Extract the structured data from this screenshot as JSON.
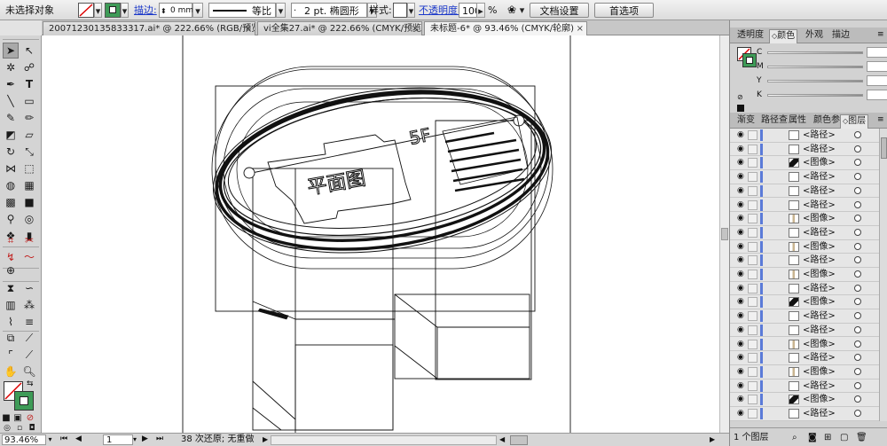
{
  "control_bar": {
    "selection_status": "未选择对象",
    "stroke_label": "描边:",
    "stroke_weight": "0 mm",
    "profile_label": "等比",
    "brush_label": "2 pt. 椭圆形",
    "style_label": "样式:",
    "opacity_label": "不透明度:",
    "opacity_value": "100",
    "opacity_unit": "%",
    "doc_setup_button": "文档设置",
    "preferences_button": "首选项"
  },
  "tabs": [
    {
      "label": "20071230135833317.ai* @ 222.66% (RGB/预览)",
      "active": false
    },
    {
      "label": "vi全集27.ai* @ 222.66% (CMYK/预览)",
      "active": false
    },
    {
      "label": "未标题-6* @ 93.46% (CMYK/轮廓)",
      "active": true
    }
  ],
  "tab_close_glyph": "×",
  "artwork": {
    "title_text": "平面图",
    "label_5f": "5F"
  },
  "status_bar": {
    "zoom": "93.46%",
    "page": "1",
    "info": "38 次还原; 无重做"
  },
  "color_panel": {
    "tabs": [
      "透明度",
      "颜色",
      "外观",
      "描边"
    ],
    "active_tab": "颜色",
    "channels": [
      "C",
      "M",
      "Y",
      "K"
    ],
    "channel_values": [
      "",
      "",
      "",
      ""
    ]
  },
  "layers_panel": {
    "tabs": [
      "渐变",
      "路径查",
      "属性",
      "颜色参",
      "图层"
    ],
    "active_tab": "图层",
    "rows": [
      {
        "name": "<路径>",
        "thumb": "blank"
      },
      {
        "name": "<路径>",
        "thumb": "blank"
      },
      {
        "name": "<图像>",
        "thumb": "dark"
      },
      {
        "name": "<路径>",
        "thumb": "blank"
      },
      {
        "name": "<路径>",
        "thumb": "blank"
      },
      {
        "name": "<路径>",
        "thumb": "blank"
      },
      {
        "name": "<图像>",
        "thumb": "img"
      },
      {
        "name": "<路径>",
        "thumb": "blank"
      },
      {
        "name": "<图像>",
        "thumb": "img"
      },
      {
        "name": "<路径>",
        "thumb": "blank"
      },
      {
        "name": "<图像>",
        "thumb": "img"
      },
      {
        "name": "<路径>",
        "thumb": "blank"
      },
      {
        "name": "<图像>",
        "thumb": "dark"
      },
      {
        "name": "<路径>",
        "thumb": "blank"
      },
      {
        "name": "<路径>",
        "thumb": "blank"
      },
      {
        "name": "<图像>",
        "thumb": "img"
      },
      {
        "name": "<路径>",
        "thumb": "blank"
      },
      {
        "name": "<图像>",
        "thumb": "img"
      },
      {
        "name": "<路径>",
        "thumb": "blank"
      },
      {
        "name": "<图像>",
        "thumb": "dark"
      },
      {
        "name": "<路径>",
        "thumb": "blank"
      }
    ],
    "layer_count": "1 个图层"
  }
}
